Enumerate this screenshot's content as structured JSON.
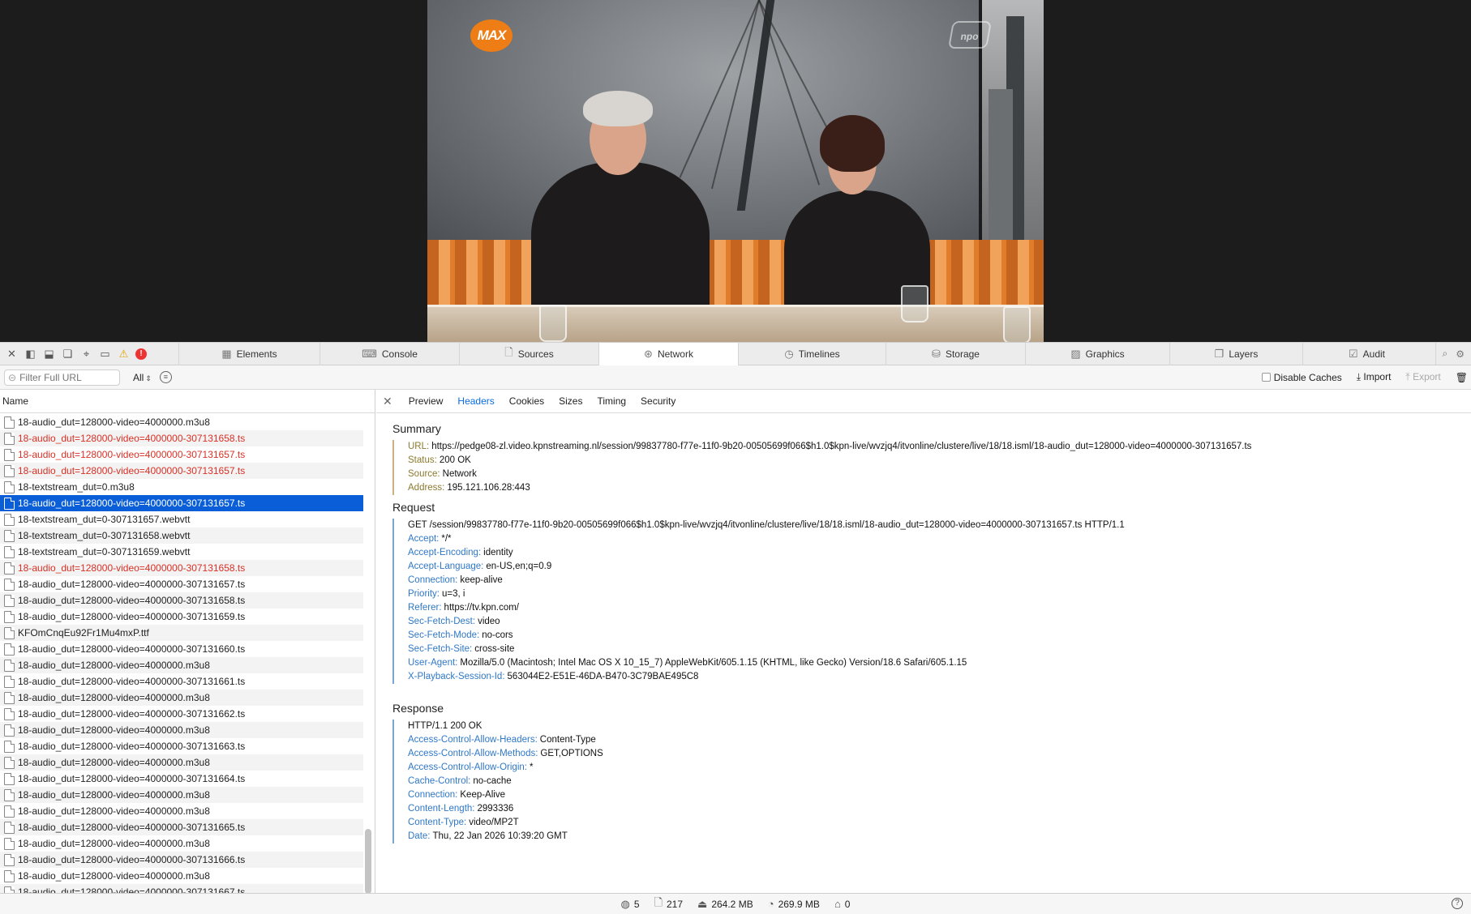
{
  "video": {
    "channel_logo": "MAX",
    "broadcaster_logo": "npo"
  },
  "toolbar": {
    "icons": [
      "close-icon",
      "dock-left-icon",
      "dock-bottom-icon",
      "detach-icon",
      "crosshair-icon",
      "device-icon",
      "warning-icon",
      "error-icon"
    ],
    "error_glyph": "!",
    "warning_glyph": "⚠",
    "tabs": [
      {
        "label": "Elements",
        "icon": "elements-icon",
        "glyph": "▦"
      },
      {
        "label": "Console",
        "icon": "console-icon",
        "glyph": "⌨"
      },
      {
        "label": "Sources",
        "icon": "sources-icon",
        "glyph": "🗋"
      },
      {
        "label": "Network",
        "icon": "network-icon",
        "glyph": "⊛",
        "active": true
      },
      {
        "label": "Timelines",
        "icon": "timelines-icon",
        "glyph": "◷"
      },
      {
        "label": "Storage",
        "icon": "storage-icon",
        "glyph": "⛁"
      },
      {
        "label": "Graphics",
        "icon": "graphics-icon",
        "glyph": "▨"
      },
      {
        "label": "Layers",
        "icon": "layers-icon",
        "glyph": "❐"
      },
      {
        "label": "Audit",
        "icon": "audit-icon",
        "glyph": "☑"
      }
    ]
  },
  "filter": {
    "placeholder": "Filter Full URL",
    "type_selected": "All",
    "disable_caches": "Disable Caches",
    "import": "Import",
    "export": "Export"
  },
  "list": {
    "column_name": "Name",
    "rows": [
      {
        "name": "18-audio_dut=128000-video=4000000.m3u8",
        "status": "normal"
      },
      {
        "name": "18-audio_dut=128000-video=4000000-307131658.ts",
        "status": "error"
      },
      {
        "name": "18-audio_dut=128000-video=4000000-307131657.ts",
        "status": "error"
      },
      {
        "name": "18-audio_dut=128000-video=4000000-307131657.ts",
        "status": "error"
      },
      {
        "name": "18-textstream_dut=0.m3u8",
        "status": "normal"
      },
      {
        "name": "18-audio_dut=128000-video=4000000-307131657.ts",
        "status": "selected"
      },
      {
        "name": "18-textstream_dut=0-307131657.webvtt",
        "status": "normal"
      },
      {
        "name": "18-textstream_dut=0-307131658.webvtt",
        "status": "normal"
      },
      {
        "name": "18-textstream_dut=0-307131659.webvtt",
        "status": "normal"
      },
      {
        "name": "18-audio_dut=128000-video=4000000-307131658.ts",
        "status": "error"
      },
      {
        "name": "18-audio_dut=128000-video=4000000-307131657.ts",
        "status": "normal"
      },
      {
        "name": "18-audio_dut=128000-video=4000000-307131658.ts",
        "status": "normal"
      },
      {
        "name": "18-audio_dut=128000-video=4000000-307131659.ts",
        "status": "normal"
      },
      {
        "name": "KFOmCnqEu92Fr1Mu4mxP.ttf",
        "status": "normal"
      },
      {
        "name": "18-audio_dut=128000-video=4000000-307131660.ts",
        "status": "normal"
      },
      {
        "name": "18-audio_dut=128000-video=4000000.m3u8",
        "status": "normal"
      },
      {
        "name": "18-audio_dut=128000-video=4000000-307131661.ts",
        "status": "normal"
      },
      {
        "name": "18-audio_dut=128000-video=4000000.m3u8",
        "status": "normal"
      },
      {
        "name": "18-audio_dut=128000-video=4000000-307131662.ts",
        "status": "normal"
      },
      {
        "name": "18-audio_dut=128000-video=4000000.m3u8",
        "status": "normal"
      },
      {
        "name": "18-audio_dut=128000-video=4000000-307131663.ts",
        "status": "normal"
      },
      {
        "name": "18-audio_dut=128000-video=4000000.m3u8",
        "status": "normal"
      },
      {
        "name": "18-audio_dut=128000-video=4000000-307131664.ts",
        "status": "normal"
      },
      {
        "name": "18-audio_dut=128000-video=4000000.m3u8",
        "status": "normal"
      },
      {
        "name": "18-audio_dut=128000-video=4000000.m3u8",
        "status": "normal"
      },
      {
        "name": "18-audio_dut=128000-video=4000000-307131665.ts",
        "status": "normal"
      },
      {
        "name": "18-audio_dut=128000-video=4000000.m3u8",
        "status": "normal"
      },
      {
        "name": "18-audio_dut=128000-video=4000000-307131666.ts",
        "status": "normal"
      },
      {
        "name": "18-audio_dut=128000-video=4000000.m3u8",
        "status": "normal"
      },
      {
        "name": "18-audio_dut=128000-video=4000000-307131667.ts",
        "status": "normal"
      }
    ]
  },
  "detail": {
    "tabs": [
      {
        "label": "Preview"
      },
      {
        "label": "Headers",
        "active": true
      },
      {
        "label": "Cookies"
      },
      {
        "label": "Sizes"
      },
      {
        "label": "Timing"
      },
      {
        "label": "Security"
      }
    ],
    "summary": {
      "title": "Summary",
      "items": [
        {
          "key": "URL:",
          "value": "https://pedge08-zl.video.kpnstreaming.nl/session/99837780-f77e-11f0-9b20-00505699f066$h1.0$kpn-live/wvzjq4/itvonline/clustere/live/18/18.isml/18-audio_dut=128000-video=4000000-307131657.ts"
        },
        {
          "key": "Status:",
          "value": "200 OK"
        },
        {
          "key": "Source:",
          "value": "Network"
        },
        {
          "key": "Address:",
          "value": "195.121.106.28:443"
        }
      ]
    },
    "request": {
      "title": "Request",
      "line": "GET /session/99837780-f77e-11f0-9b20-00505699f066$h1.0$kpn-live/wvzjq4/itvonline/clustere/live/18/18.isml/18-audio_dut=128000-video=4000000-307131657.ts HTTP/1.1",
      "headers": [
        {
          "key": "Accept:",
          "value": "*/*"
        },
        {
          "key": "Accept-Encoding:",
          "value": "identity"
        },
        {
          "key": "Accept-Language:",
          "value": "en-US,en;q=0.9"
        },
        {
          "key": "Connection:",
          "value": "keep-alive"
        },
        {
          "key": "Priority:",
          "value": "u=3, i"
        },
        {
          "key": "Referer:",
          "value": "https://tv.kpn.com/"
        },
        {
          "key": "Sec-Fetch-Dest:",
          "value": "video"
        },
        {
          "key": "Sec-Fetch-Mode:",
          "value": "no-cors"
        },
        {
          "key": "Sec-Fetch-Site:",
          "value": "cross-site"
        },
        {
          "key": "User-Agent:",
          "value": "Mozilla/5.0 (Macintosh; Intel Mac OS X 10_15_7) AppleWebKit/605.1.15 (KHTML, like Gecko) Version/18.6 Safari/605.1.15"
        },
        {
          "key": "X-Playback-Session-Id:",
          "value": "563044E2-E51E-46DA-B470-3C79BAE495C8"
        }
      ]
    },
    "response": {
      "title": "Response",
      "line": "HTTP/1.1 200 OK",
      "headers": [
        {
          "key": "Access-Control-Allow-Headers:",
          "value": "Content-Type"
        },
        {
          "key": "Access-Control-Allow-Methods:",
          "value": "GET,OPTIONS"
        },
        {
          "key": "Access-Control-Allow-Origin:",
          "value": "*"
        },
        {
          "key": "Cache-Control:",
          "value": "no-cache"
        },
        {
          "key": "Connection:",
          "value": "Keep-Alive"
        },
        {
          "key": "Content-Length:",
          "value": "2993336"
        },
        {
          "key": "Content-Type:",
          "value": "video/MP2T"
        },
        {
          "key": "Date:",
          "value": "Thu, 22 Jan 2026 10:39:20 GMT"
        }
      ]
    }
  },
  "statusbar": {
    "domains": "5",
    "resources": "217",
    "transferred": "264.2 MB",
    "size": "269.9 MB",
    "redirects": "0",
    "help": "?"
  }
}
